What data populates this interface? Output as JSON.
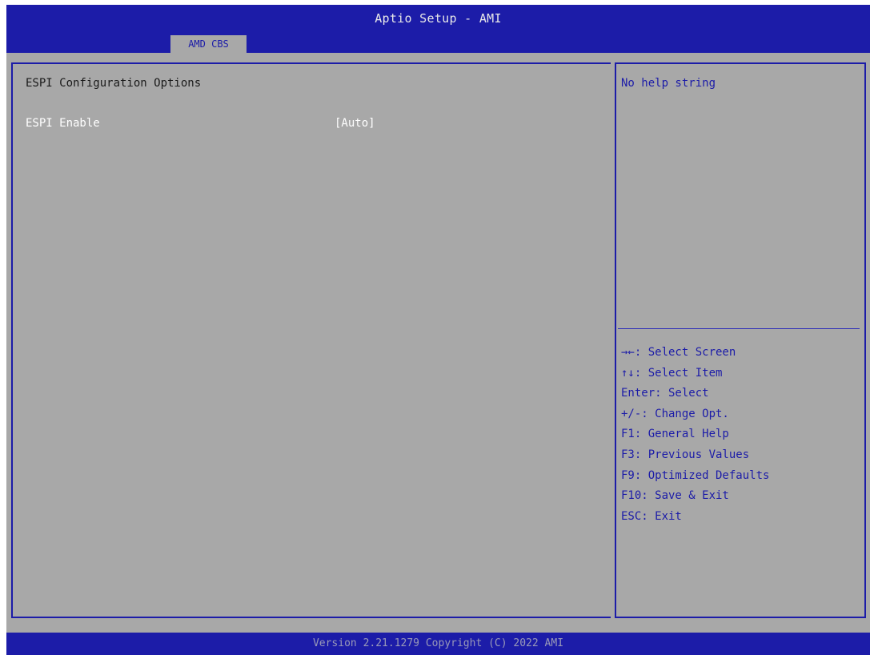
{
  "header": {
    "title": "Aptio Setup - AMI",
    "active_tab": "AMD CBS"
  },
  "main": {
    "section_title": "ESPI Configuration Options",
    "options": [
      {
        "label": "ESPI Enable",
        "value": "[Auto]"
      }
    ]
  },
  "help": {
    "text": "No help string",
    "keys": [
      "→←: Select Screen",
      "↑↓: Select Item",
      "Enter: Select",
      "+/-: Change Opt.",
      "F1: General Help",
      "F3: Previous Values",
      "F9: Optimized Defaults",
      "F10: Save & Exit",
      "ESC: Exit"
    ]
  },
  "footer": {
    "version": "Version 2.21.1279 Copyright (C) 2022 AMI"
  },
  "colors": {
    "blue": "#1c1ca8",
    "gray": "#a8a8a8",
    "white_text": "#ffffff"
  }
}
